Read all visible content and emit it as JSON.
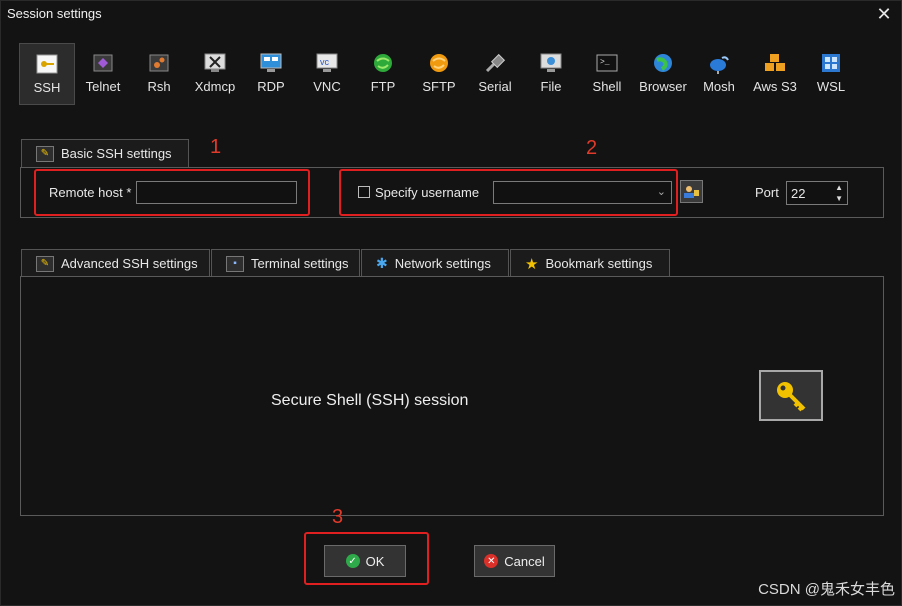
{
  "window": {
    "title": "Session settings"
  },
  "protocols": [
    {
      "label": "SSH",
      "icon": "ssh-key-icon",
      "active": true
    },
    {
      "label": "Telnet",
      "icon": "telnet-icon"
    },
    {
      "label": "Rsh",
      "icon": "rsh-icon"
    },
    {
      "label": "Xdmcp",
      "icon": "xdmcp-icon"
    },
    {
      "label": "RDP",
      "icon": "rdp-icon"
    },
    {
      "label": "VNC",
      "icon": "vnc-icon"
    },
    {
      "label": "FTP",
      "icon": "ftp-icon"
    },
    {
      "label": "SFTP",
      "icon": "sftp-icon"
    },
    {
      "label": "Serial",
      "icon": "serial-icon"
    },
    {
      "label": "File",
      "icon": "file-icon"
    },
    {
      "label": "Shell",
      "icon": "shell-icon"
    },
    {
      "label": "Browser",
      "icon": "browser-icon"
    },
    {
      "label": "Mosh",
      "icon": "mosh-icon"
    },
    {
      "label": "Aws S3",
      "icon": "aws-s3-icon"
    },
    {
      "label": "WSL",
      "icon": "wsl-icon"
    }
  ],
  "basic": {
    "tab_label": "Basic SSH settings",
    "remote_host_label": "Remote host *",
    "remote_host_value": "",
    "specify_username_label": "Specify username",
    "username_value": "",
    "port_label": "Port",
    "port_value": "22"
  },
  "annotations": {
    "n1": "1",
    "n2": "2",
    "n3": "3"
  },
  "tabs": [
    {
      "label": "Advanced SSH settings"
    },
    {
      "label": "Terminal settings"
    },
    {
      "label": "Network settings"
    },
    {
      "label": "Bookmark settings"
    }
  ],
  "content": {
    "description": "Secure Shell (SSH) session"
  },
  "buttons": {
    "ok": "OK",
    "cancel": "Cancel"
  },
  "watermark": "CSDN @鬼禾女丰色",
  "colors": {
    "annotation_red": "#e02020",
    "ok_green": "#2eaa4a",
    "cancel_red": "#d9302a",
    "key_yellow": "#f2c200"
  }
}
